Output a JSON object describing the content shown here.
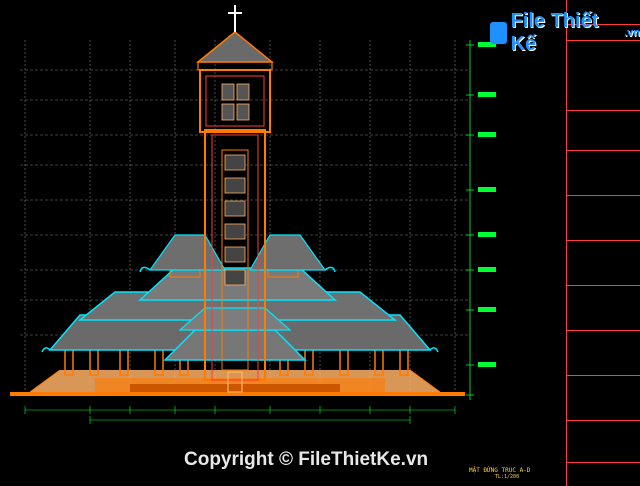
{
  "watermark": {
    "brand": "File Thiết Kế",
    "brand_suffix": ".vn",
    "copyright": "Copyright © FileThietKe.vn"
  },
  "sheet": {
    "title": "MẶT ĐỨNG TRỤC A-D",
    "scale": "TL:1/200"
  },
  "colors": {
    "background": "#000000",
    "roof_cyan": "#00e5ff",
    "wall_orange": "#ff7a00",
    "accent_red": "#ff3b3b",
    "grid_green": "#00ff33",
    "base_orange": "#ffb266",
    "cross_white": "#ffffff"
  },
  "icons": [
    "cross-icon",
    "logo-icon"
  ]
}
